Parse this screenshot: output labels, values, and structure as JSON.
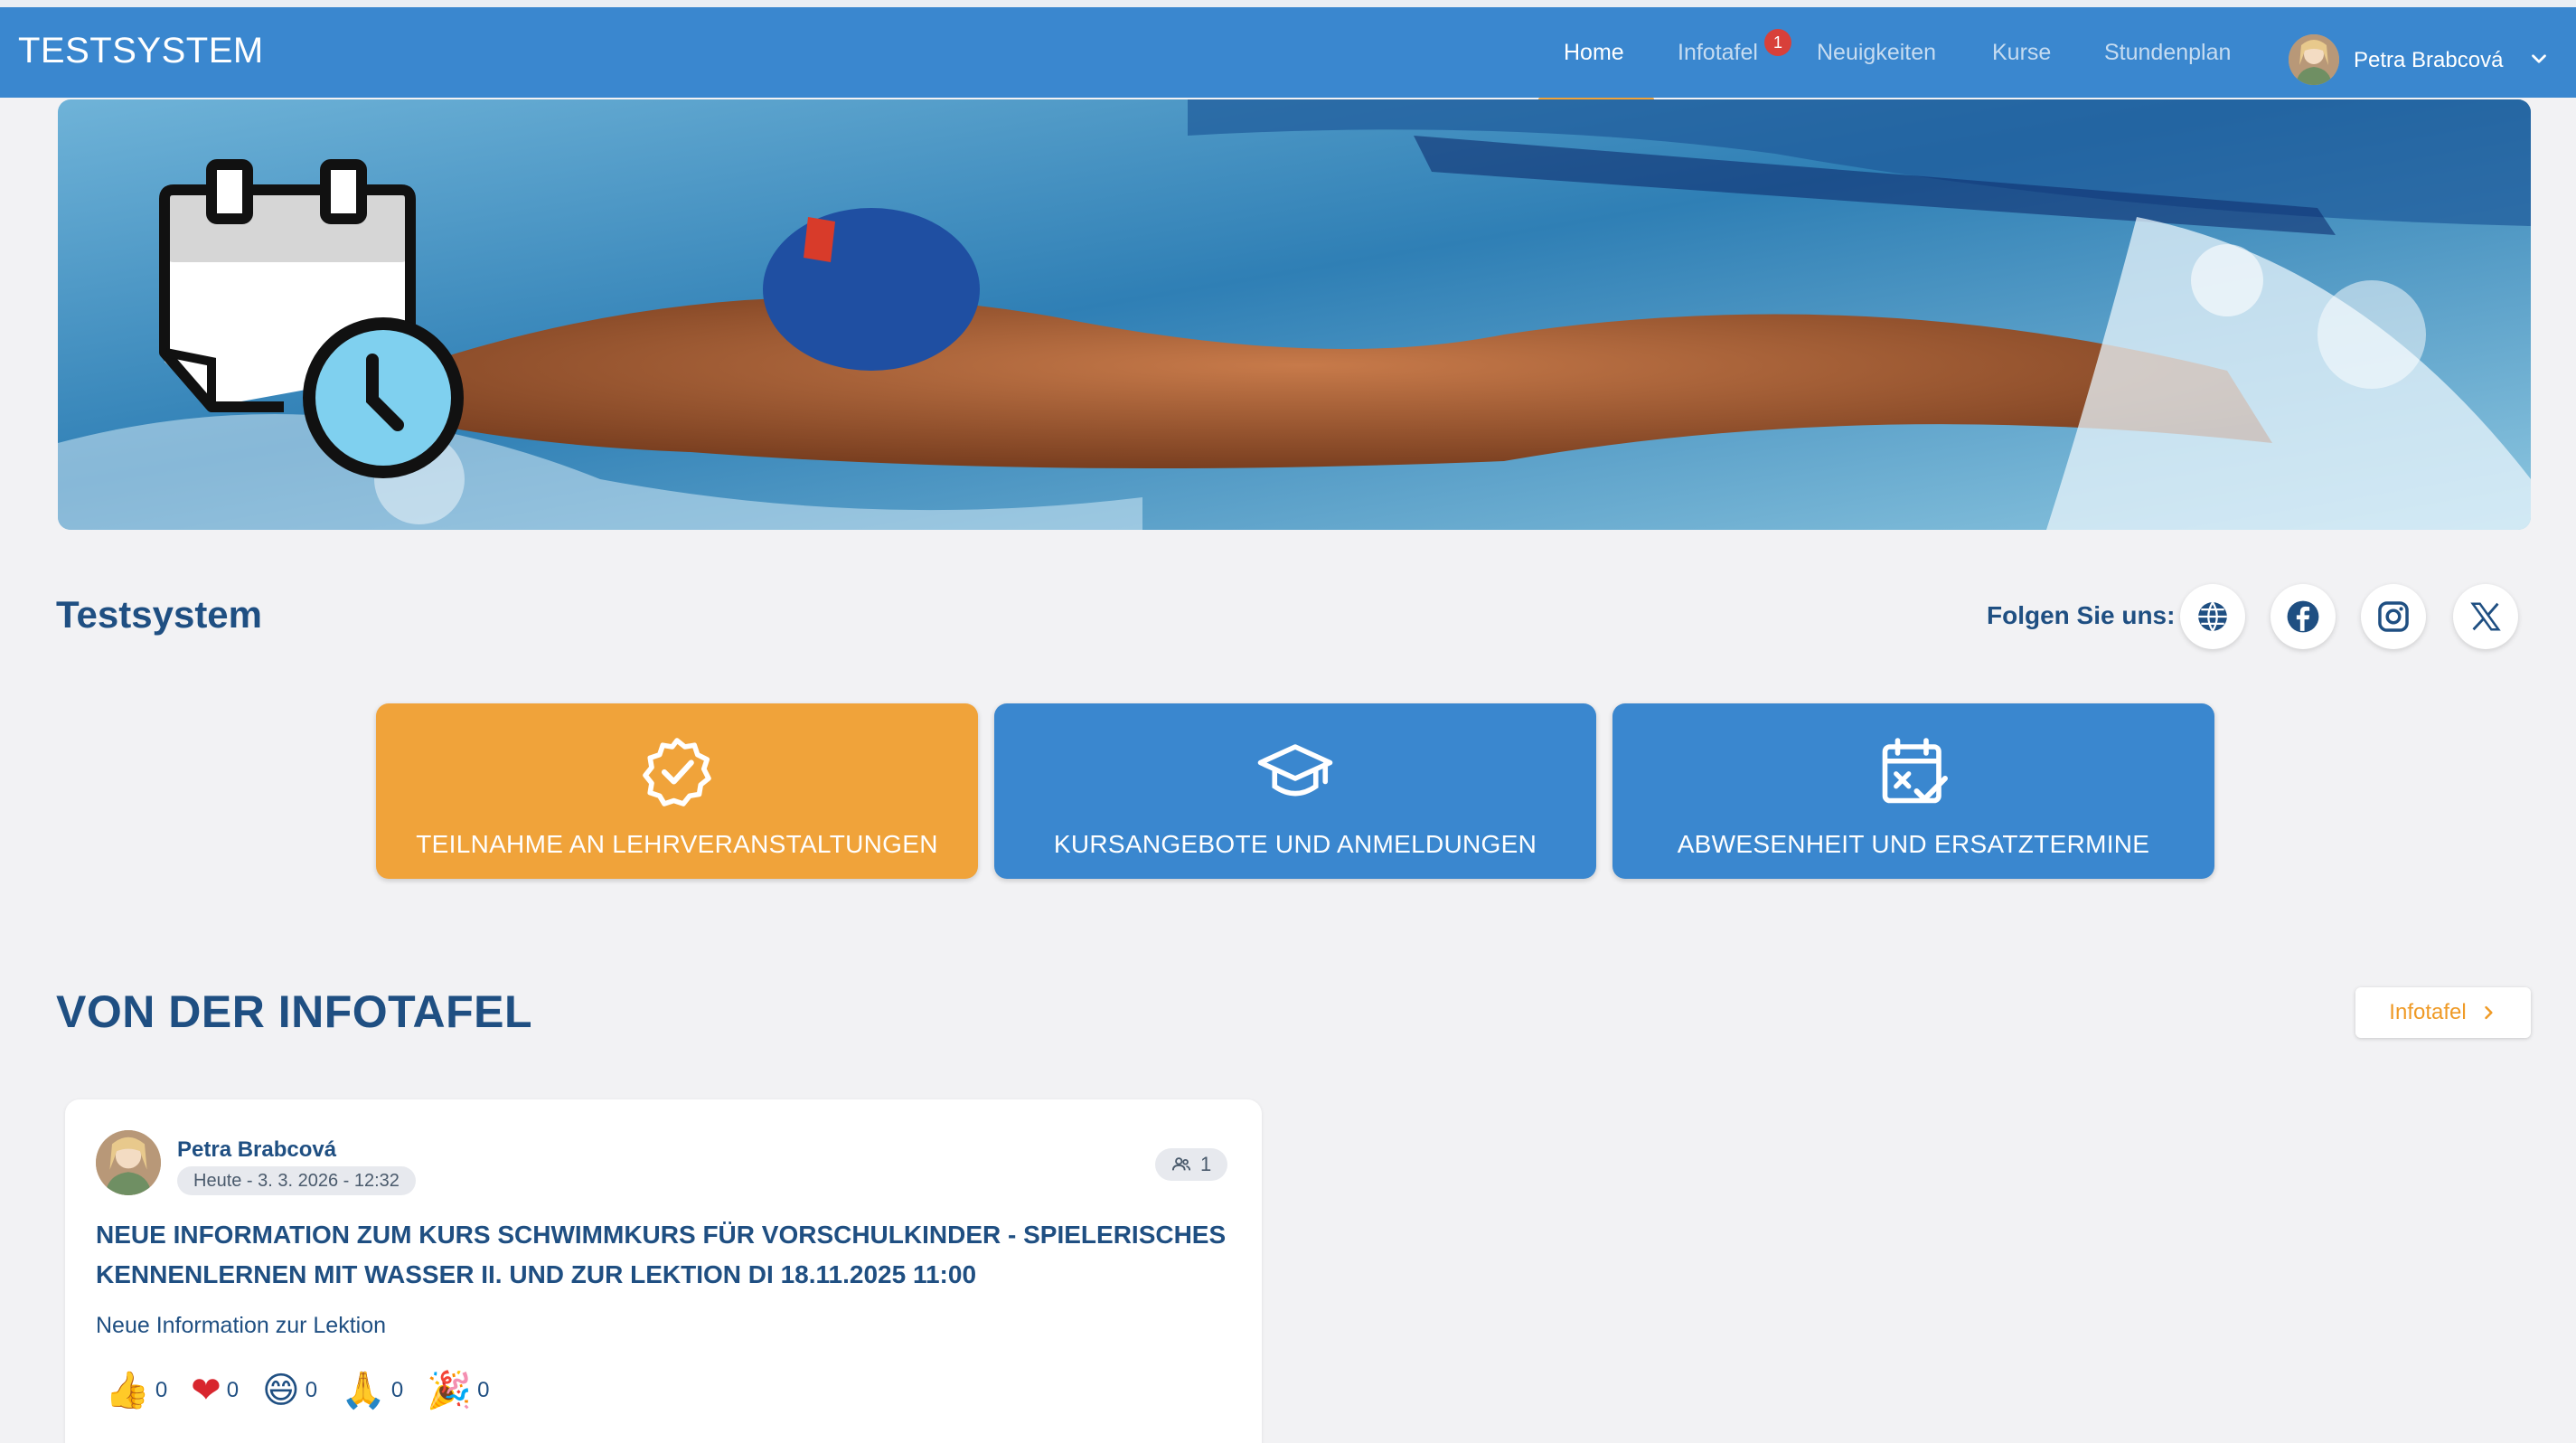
{
  "brand": "TESTSYSTEM",
  "nav": {
    "items": [
      {
        "label": "Home"
      },
      {
        "label": "Infotafel",
        "badge": "1"
      },
      {
        "label": "Neuigkeiten"
      },
      {
        "label": "Kurse"
      },
      {
        "label": "Stundenplan"
      }
    ],
    "user_name": "Petra Brabcová"
  },
  "org": {
    "title": "Testsystem",
    "follow_label": "Folgen Sie uns:",
    "social_icons": [
      "globe-icon",
      "facebook-icon",
      "instagram-icon",
      "x-icon"
    ]
  },
  "tiles": [
    {
      "label": "TEILNAHME AN LEHRVERANSTALTUNGEN",
      "icon": "verified-badge-icon",
      "color": "#f0a33a"
    },
    {
      "label": "KURSANGEBOTE UND ANMELDUNGEN",
      "icon": "graduation-cap-icon",
      "color": "#3a87cf"
    },
    {
      "label": "ABWESENHEIT UND ERSATZTERMINE",
      "icon": "calendar-check-icon",
      "color": "#3a87cf"
    }
  ],
  "section": {
    "title": "VON DER INFOTAFEL",
    "button_label": "Infotafel"
  },
  "post": {
    "author": "Petra Brabcová",
    "date": "Heute - 3. 3. 2026 - 12:32",
    "recipients": "1",
    "title_line1": "NEUE INFORMATION ZUM KURS SCHWIMMKURS FÜR VORSCHULKINDER - SPIELERISCHES",
    "title_line2": "KENNENLERNEN MIT WASSER II. UND ZUR LEKTION DI 18.11.2025 11:00",
    "body": "Neue Information zur Lektion",
    "reactions": [
      {
        "emoji": "👍",
        "count": "0"
      },
      {
        "emoji": "❤",
        "count": "0"
      },
      {
        "emoji": "😄",
        "count": "0"
      },
      {
        "emoji": "🙏",
        "count": "0"
      },
      {
        "emoji": "🎉",
        "count": "0"
      }
    ]
  },
  "colors": {
    "primary": "#3a87cf",
    "accent": "#f0a33a",
    "text": "#1f4f82",
    "badge": "#d8403a"
  }
}
